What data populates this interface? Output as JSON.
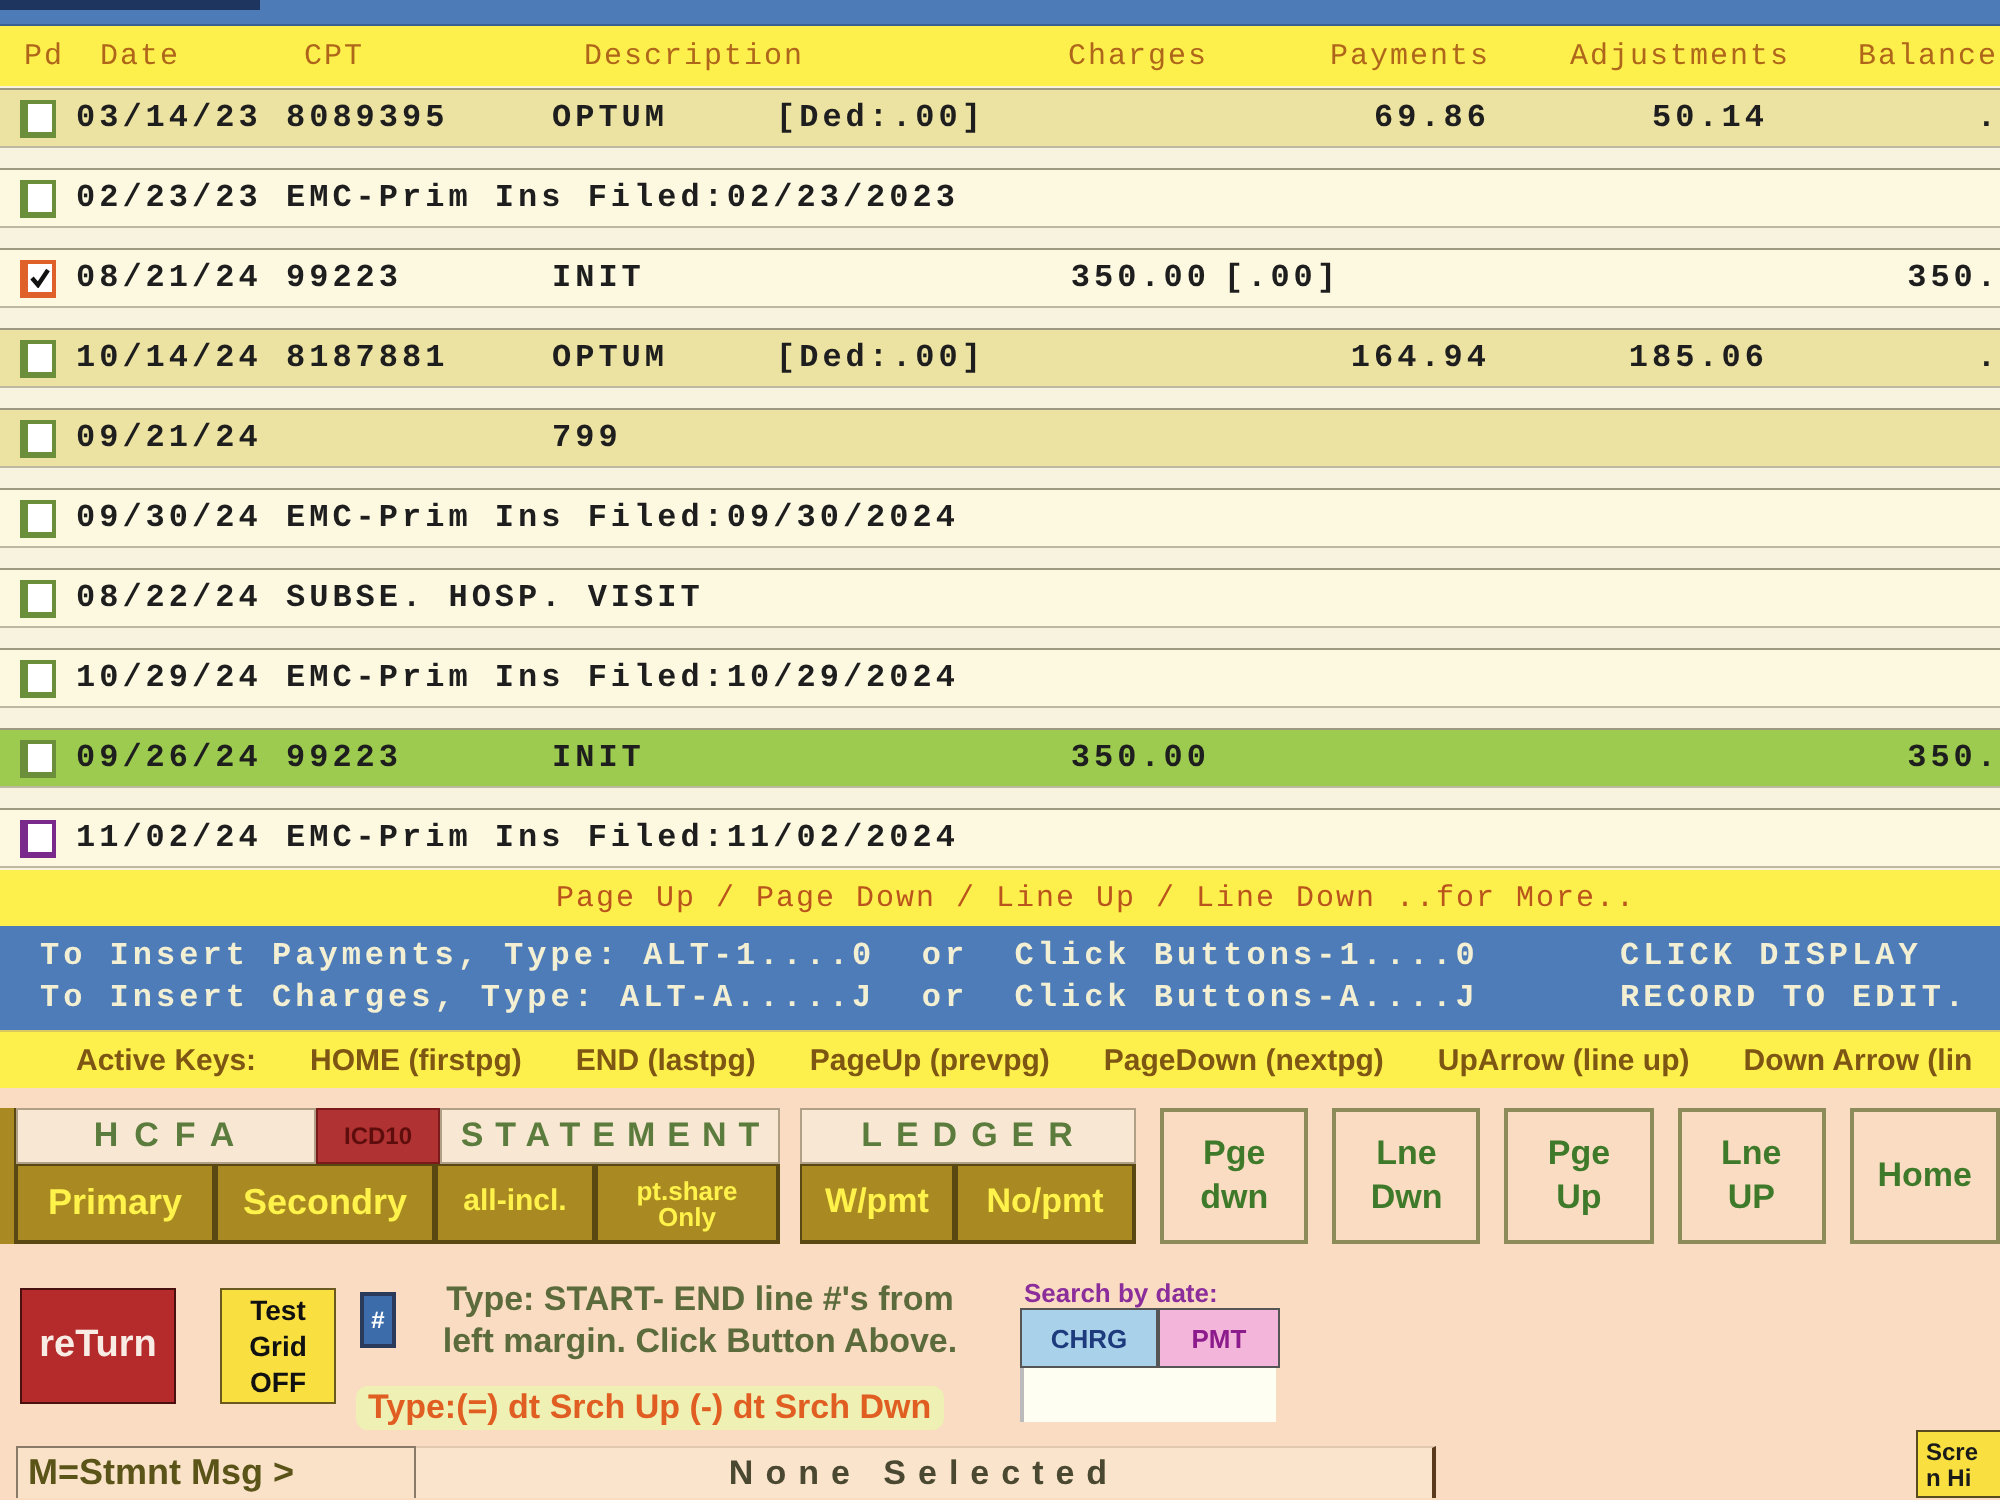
{
  "ledger": {
    "columns": [
      "Pd",
      "Date",
      "CPT",
      "Description",
      "Charges",
      "Payments",
      "Adjustments",
      "Balance"
    ],
    "rows": [
      {
        "checked": false,
        "color": "#6b8e3a",
        "shaded": true,
        "selected": false,
        "date": "03/14/23",
        "cpt": "8089395",
        "description": "OPTUM",
        "note": "[Ded:.00]",
        "payments": "69.86",
        "adjustments": "50.14",
        "balance": "."
      },
      {
        "checked": false,
        "color": "#6b8e3a",
        "shaded": false,
        "selected": false,
        "date": "02/23/23",
        "memo": "EMC-Prim Ins Filed:02/23/2023"
      },
      {
        "checked": true,
        "color": "#e0602a",
        "shaded": false,
        "selected": false,
        "date": "08/21/24",
        "cpt": "99223",
        "description": "INIT",
        "charges": "350.00",
        "charges_note": "[.00]",
        "balance": "350."
      },
      {
        "checked": false,
        "color": "#6b8e3a",
        "shaded": true,
        "selected": false,
        "date": "10/14/24",
        "cpt": "8187881",
        "description": "OPTUM",
        "note": "[Ded:.00]",
        "payments": "164.94",
        "adjustments": "185.06",
        "balance": "."
      },
      {
        "checked": false,
        "color": "#6b8e3a",
        "shaded": true,
        "selected": false,
        "date": "09/21/24",
        "description": "799"
      },
      {
        "checked": false,
        "color": "#6b8e3a",
        "shaded": false,
        "selected": false,
        "date": "09/30/24",
        "memo": "EMC-Prim Ins Filed:09/30/2024"
      },
      {
        "checked": false,
        "color": "#6b8e3a",
        "shaded": false,
        "selected": false,
        "date": "08/22/24",
        "memo": "SUBSE. HOSP. VISIT"
      },
      {
        "checked": false,
        "color": "#6b8e3a",
        "shaded": false,
        "selected": false,
        "date": "10/29/24",
        "memo": "EMC-Prim Ins Filed:10/29/2024"
      },
      {
        "checked": false,
        "color": "#6b8e3a",
        "shaded": false,
        "selected": true,
        "date": "09/26/24",
        "cpt": "99223",
        "description": "INIT",
        "charges": "350.00",
        "balance": "350."
      },
      {
        "checked": false,
        "color": "#7a2a8a",
        "shaded": false,
        "selected": false,
        "date": "11/02/24",
        "memo": "EMC-Prim Ins Filed:11/02/2024"
      }
    ]
  },
  "more_hint": "Page Up / Page Down / Line Up / Line Down ..for More..",
  "info_bar": {
    "lines": [
      "To Insert Payments, Type: ALT-1....0  or  Click Buttons-1....0",
      "To Insert Charges, Type: ALT-A.....J  or  Click Buttons-A....J"
    ],
    "note": "CLICK DISPLAY RECORD TO EDIT."
  },
  "active_keys": {
    "label": "Active Keys:",
    "keys": [
      "HOME (firstpg)",
      "END (lastpg)",
      "PageUp (prevpg)",
      "PageDown (nextpg)",
      "UpArrow (line up)",
      "Down Arrow (lin"
    ]
  },
  "print_panel": {
    "hcfa_title": "HCFA",
    "icd_button": "ICD10",
    "statement_title": "STATEMENT",
    "buttons": [
      "Primary",
      "Secondry",
      "all-incl.",
      "pt.share Only"
    ]
  },
  "ledger_panel": {
    "title": "LEDGER",
    "buttons": [
      "W/pmt",
      "No/pmt"
    ]
  },
  "nav_buttons": [
    "Pge dwn",
    "Lne Dwn",
    "Pge Up",
    "Lne UP",
    "Home"
  ],
  "return_button": "reTurn",
  "test_grid_button": "Test Grid OFF",
  "line_button": "#",
  "line_hint": "Type: START- END line #'s from left margin. Click Button Above.",
  "search_hint": "Type:(=) dt Srch Up (-) dt Srch Dwn",
  "date_search": {
    "label": "Search by date:",
    "buttons": [
      {
        "kind": "charge",
        "label": "CHRG"
      },
      {
        "kind": "payment",
        "label": "PMT"
      }
    ]
  },
  "message": {
    "label": "M=Stmnt Msg >",
    "status": "None Selected"
  },
  "screen_button": "Scre n Hi"
}
